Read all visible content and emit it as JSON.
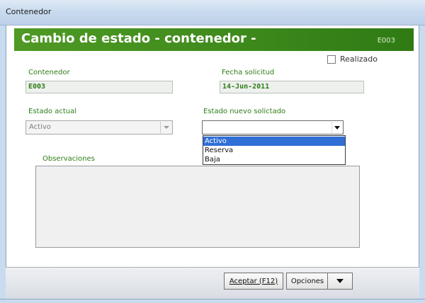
{
  "window": {
    "title": "Contenedor"
  },
  "banner": {
    "title": "Cambio de estado  - contenedor -",
    "code": "E003"
  },
  "realizado": {
    "label": "Realizado",
    "checked": false
  },
  "contenedor": {
    "label": "Contenedor",
    "value": "E003"
  },
  "fecha": {
    "label": "Fecha solicitud",
    "value": "14-Jun-2011"
  },
  "estado_actual": {
    "label": "Estado actual",
    "value": "Activo"
  },
  "estado_nuevo": {
    "label": "Estado nuevo solictado",
    "value": "",
    "options": [
      "Activo",
      "Reserva",
      "Baja"
    ],
    "highlighted": "Activo"
  },
  "observaciones": {
    "label": "Observaciones",
    "value": ""
  },
  "buttons": {
    "aceptar": "Aceptar (F12)",
    "opciones": "Opciones"
  },
  "colors": {
    "accent_green": "#3f8a1c",
    "label_green": "#2e7d18",
    "selection_blue": "#2f6fd6"
  }
}
